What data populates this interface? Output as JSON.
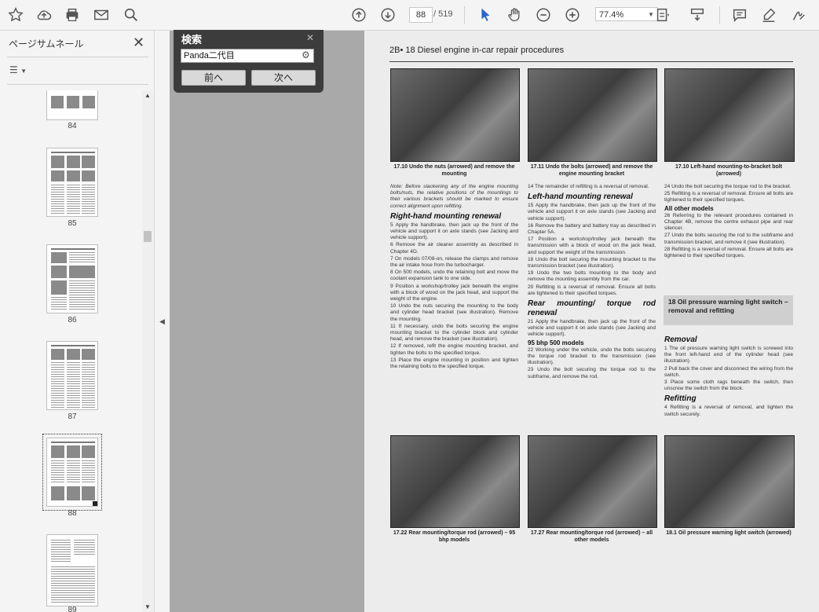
{
  "toolbar": {
    "current_page": "88",
    "page_total": "/ 519",
    "zoom": "77.4%"
  },
  "sidebar": {
    "title": "ページサムネール",
    "thumbnails": [
      {
        "label": "84"
      },
      {
        "label": "85"
      },
      {
        "label": "86"
      },
      {
        "label": "87"
      },
      {
        "label": "88",
        "selected": true
      },
      {
        "label": "89"
      }
    ]
  },
  "search": {
    "title": "検索",
    "query": "Panda二代目",
    "prev_label": "前へ",
    "next_label": "次へ"
  },
  "document": {
    "header": "2B• 18  Diesel engine in-car repair procedures",
    "captions": {
      "c1": "17.10  Undo the nuts (arrowed) and remove the mounting",
      "c2": "17.11  Undo the bolts (arrowed) and remove the engine mounting bracket",
      "c3": "17.10  Left-hand mounting-to-bracket bolt (arrowed)",
      "c4": "17.22  Rear mounting/torque rod (arrowed) – 95 bhp models",
      "c5": "17.27  Rear mounting/torque rod (arrowed) – all other models",
      "c6": "18.1  Oil pressure warning light switch (arrowed)"
    },
    "col1": {
      "note": "Note: Before slackening any of the engine mounting bolts/nuts, the relative positions of the mountings to their various brackets should be marked to ensure correct alignment upon refitting.",
      "heading": "Right-hand mounting renewal",
      "p5": "5  Apply the handbrake, then jack up the front of the vehicle and support it on axle stands (see Jacking and vehicle support).",
      "p6": "6  Remove the air cleaner assembly as described in Chapter 4D.",
      "p7": "7  On models 07/08-on, release the clamps and remove the air intake hose from the turbocharger.",
      "p8": "8  On 500 models, undo the retaining bolt and move the coolant expansion tank to one side.",
      "p9": "9  Position a workshop/trolley jack beneath the engine with a block of wood on the jack head, and support the weight of the engine.",
      "p10": "10  Undo the nuts securing the mounting to the body and cylinder head bracket (see illustration). Remove the mounting.",
      "p11": "11  If necessary, undo the bolts securing the engine mounting bracket to the cylinder block and cylinder head, and remove the bracket (see illustration).",
      "p12": "12  If removed, refit the engine mounting bracket, and tighten the bolts to the specified torque.",
      "p13": "13  Place the engine mounting in position and tighten the retaining bolts to the specified torque."
    },
    "col2": {
      "p14": "14  The remainder of refitting is a reversal of removal.",
      "heading": "Left-hand mounting renewal",
      "p15": "15  Apply the handbrake, then jack up the front of the vehicle and support it on axle stands (see Jacking and vehicle support).",
      "p16": "16  Remove the battery and battery tray as described in Chapter 5A.",
      "p17": "17  Position a workshop/trolley jack beneath the transmission with a block of wood on the jack head, and support the weight of the transmission.",
      "p18": "18  Undo the bolt securing the mounting bracket to the transmission bracket (see illustration).",
      "p19": "19  Undo the two bolts mounting to the body and remove the mounting assembly from the car.",
      "p20": "20  Refitting is a reversal of removal. Ensure all bolts are tightened to their specified torques.",
      "heading2": "Rear mounting/ torque rod renewal",
      "p21": "21  Apply the handbrake, then jack up the front of the vehicle and support it on axle stands (see Jacking and vehicle support).",
      "sub": "95 bhp 500 models",
      "p22": "22  Working under the vehicle, undo the bolts securing the torque rod bracket to the transmission (see illustration).",
      "p23": "23  Undo the bolt securing the torque rod to the subframe, and remove the rod."
    },
    "col3": {
      "p24": "24  Undo the bolt securing the torque rod to the bracket.",
      "p25": "25  Refitting is a reversal of removal. Ensure all bolts are tightened to their specified torques.",
      "sub": "All other models",
      "p26": "26  Referring to the relevant procedures contained in Chapter 4B, remove the centre exhaust pipe and rear silencer.",
      "p27": "27  Undo the bolts securing the rod to the subframe and transmission bracket, and remove it (see illustration).",
      "p28": "28  Refitting is a reversal of removal. Ensure all bolts are tightened to their specified torques.",
      "section": "18  Oil pressure warning light switch – removal and refitting",
      "heading_removal": "Removal",
      "p1": "1  The oil pressure warning light switch is screwed into the front left-hand end of the cylinder head (see illustration).",
      "p2": "2  Pull back the cover and disconnect the wiring from the switch.",
      "p3": "3  Place some cloth rags beneath the switch, then unscrew the switch from the block.",
      "heading_refit": "Refitting",
      "p4": "4  Refitting is a reversal of removal, and tighten the switch securely."
    }
  }
}
